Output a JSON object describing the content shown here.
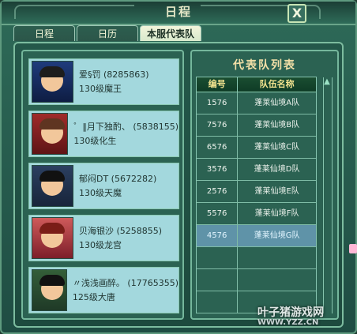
{
  "window": {
    "title": "日程",
    "close_label": "X"
  },
  "tabs": [
    {
      "label": "日程",
      "active": false
    },
    {
      "label": "日历",
      "active": false
    },
    {
      "label": "本服代表队",
      "active": true
    }
  ],
  "members": [
    {
      "name": "爱§罚 (8285863)",
      "level_class": "130级魔王"
    },
    {
      "name": "゜‖月下独酌、 (5838155)",
      "level_class": "130级化生"
    },
    {
      "name": "郁闷DT (5672282)",
      "level_class": "130级天魔"
    },
    {
      "name": "贝海银沙 (5258855)",
      "level_class": "130级龙宫"
    },
    {
      "name": "〃浅浅画醉。 (17765355)",
      "level_class": "125级大唐"
    }
  ],
  "team_list": {
    "title": "代表队列表",
    "headers": {
      "col1": "编号",
      "col2": "队伍名称"
    },
    "rows": [
      {
        "id": "1576",
        "name": "蓬莱仙境A队"
      },
      {
        "id": "7576",
        "name": "蓬莱仙境B队"
      },
      {
        "id": "6576",
        "name": "蓬莱仙境C队"
      },
      {
        "id": "3576",
        "name": "蓬莱仙境D队"
      },
      {
        "id": "2576",
        "name": "蓬莱仙境E队"
      },
      {
        "id": "5576",
        "name": "蓬莱仙境F队"
      },
      {
        "id": "4576",
        "name": "蓬莱仙境G队"
      }
    ],
    "selected_index": 6
  },
  "watermark": {
    "line1": "叶子猪游戏网",
    "line2": "WWW.YZZ.CN"
  },
  "icons": {
    "close": "close-icon",
    "scroll_up": "scroll-up-icon",
    "flower": "flower-icon"
  }
}
